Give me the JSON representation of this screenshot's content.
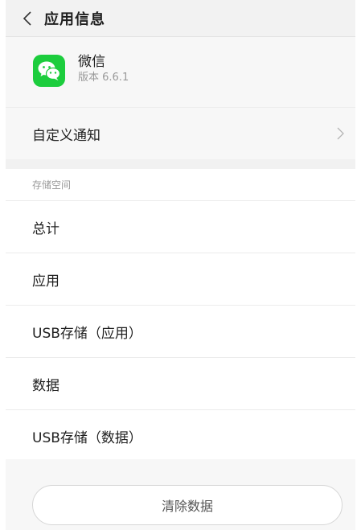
{
  "header": {
    "title": "应用信息",
    "back_icon": "chevron-left-icon"
  },
  "app": {
    "name": "微信",
    "version": "版本 6.6.1",
    "icon": "wechat-icon",
    "icon_color": "#1ccd3d"
  },
  "notify": {
    "label": "自定义通知",
    "icon": "chevron-right-icon"
  },
  "storage": {
    "section_title": "存储空间",
    "rows": [
      "总计",
      "应用",
      "USB存储（应用）",
      "数据",
      "USB存储（数据）"
    ]
  },
  "actions": {
    "clear_data_label": "清除数据"
  }
}
